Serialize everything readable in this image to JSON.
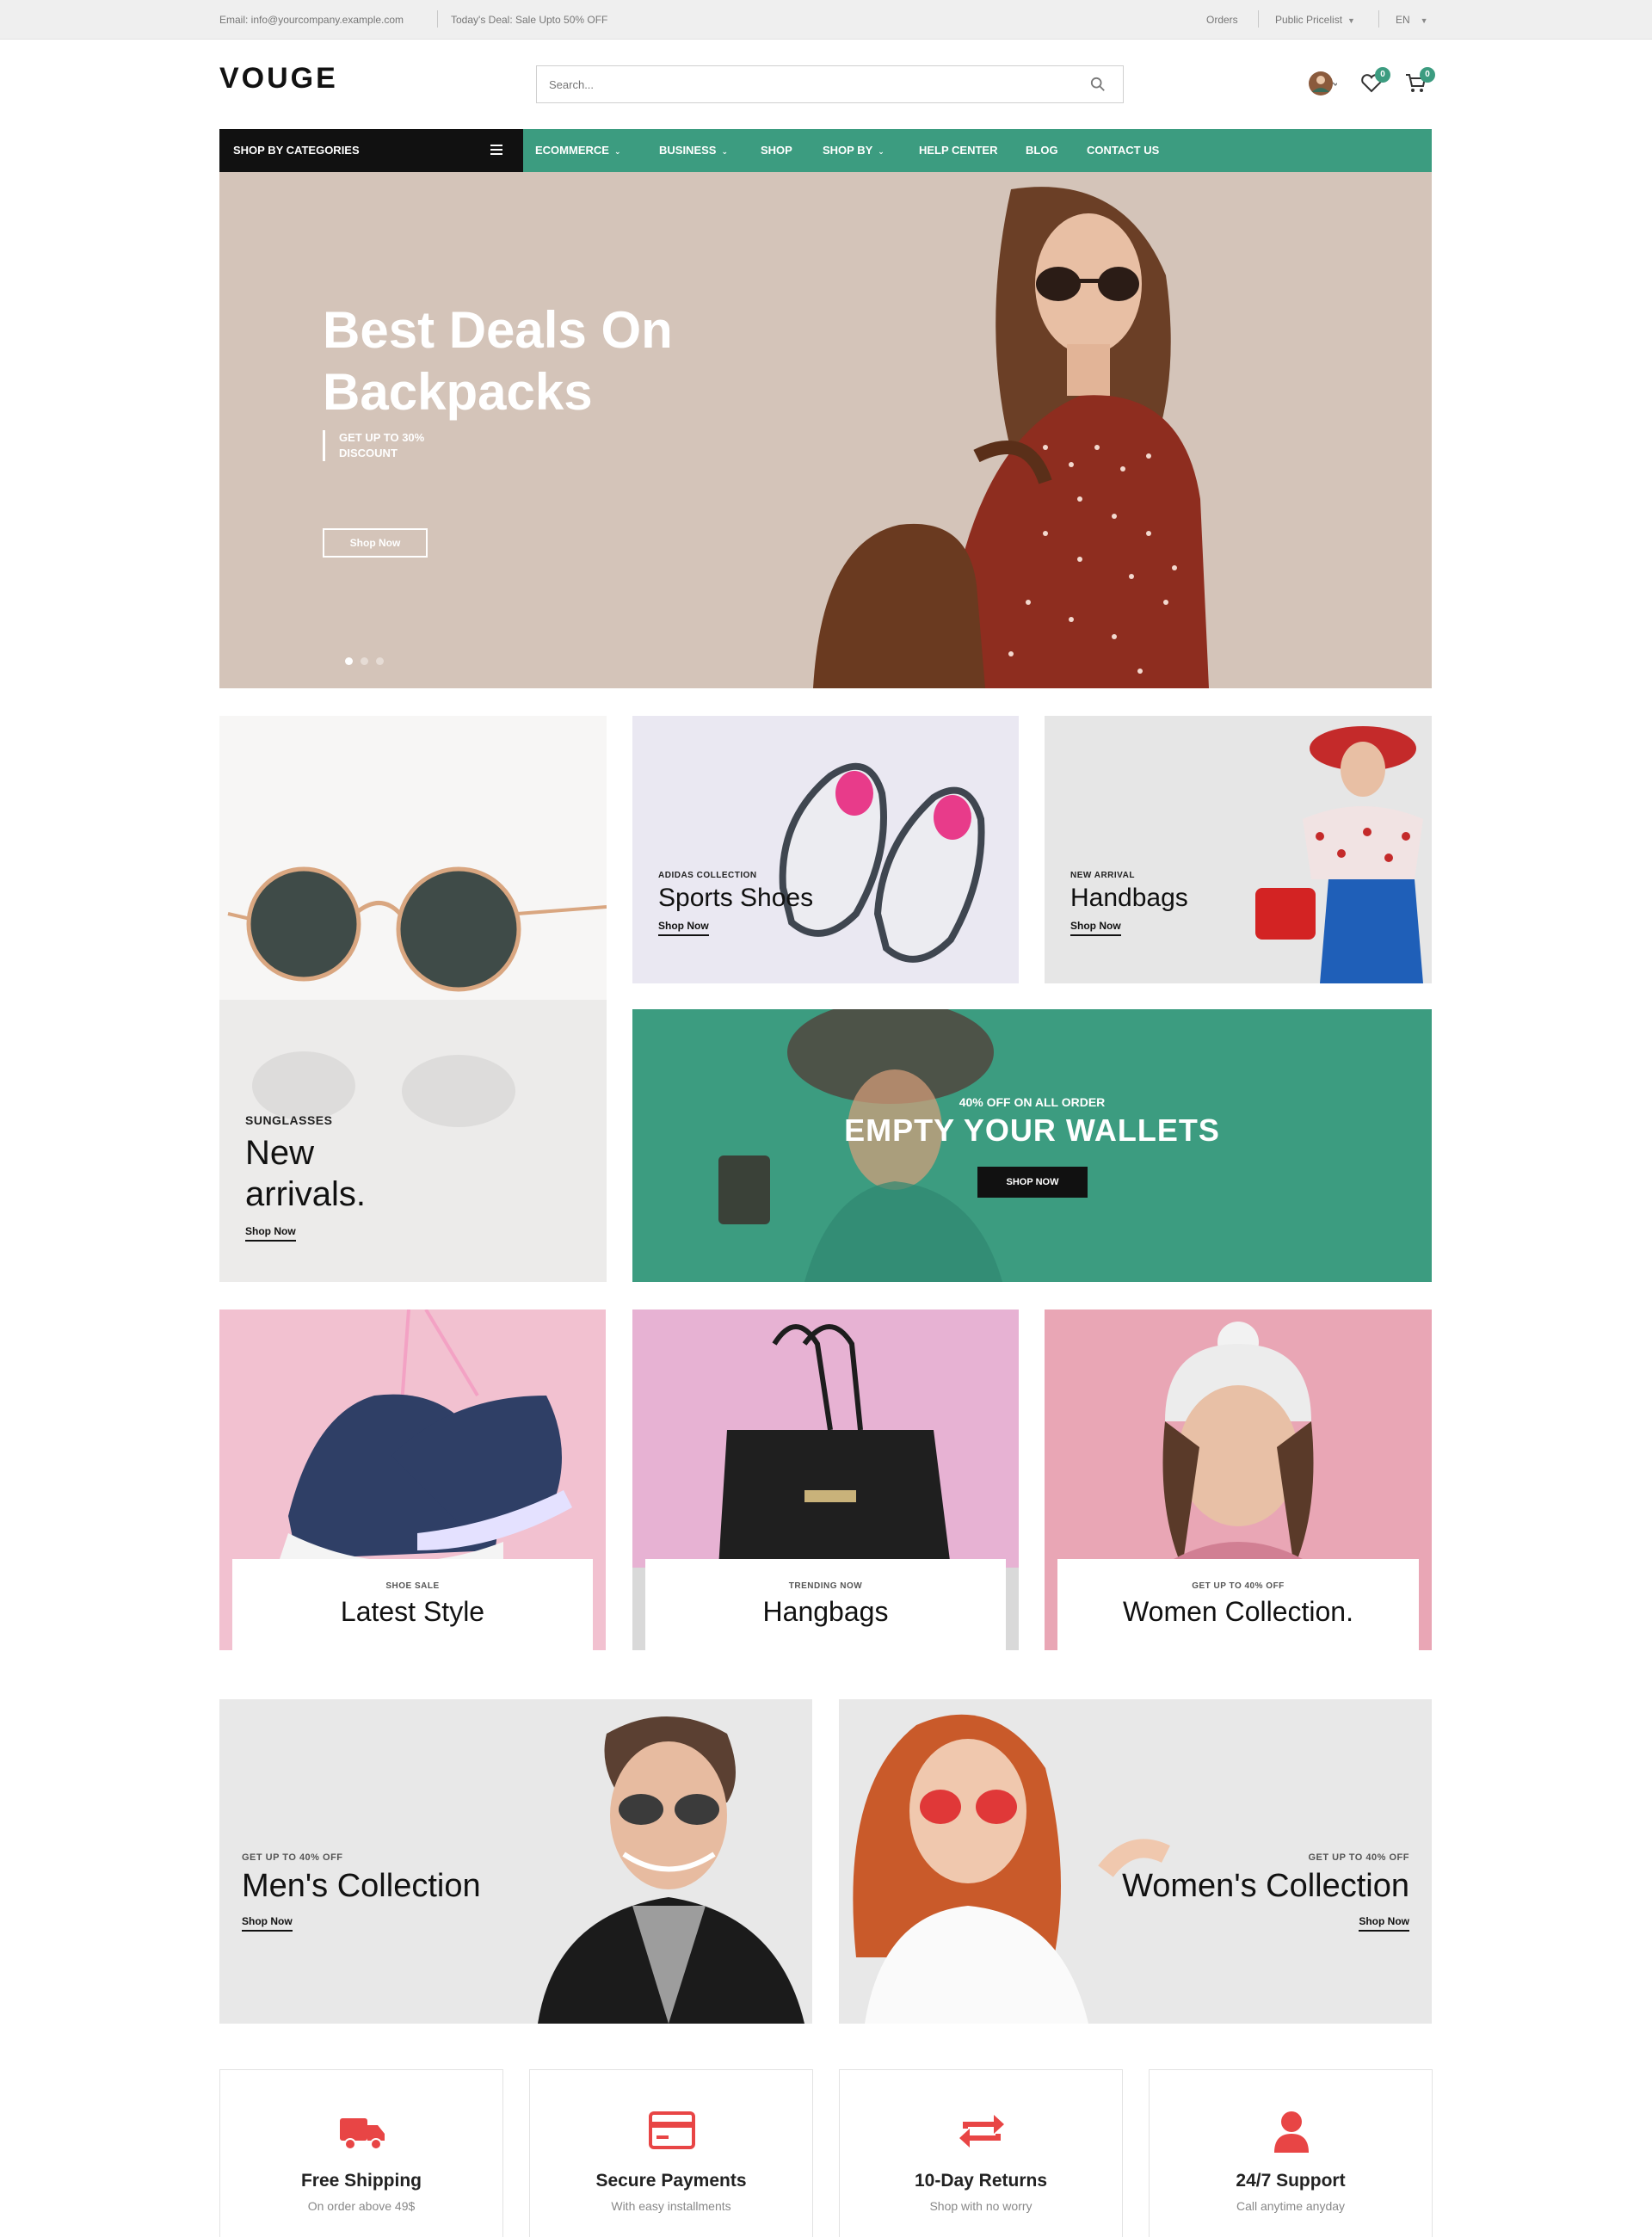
{
  "topbar": {
    "email": "Email:  info@yourcompany.example.com",
    "deal": "Today's Deal:  Sale Upto 50% OFF",
    "orders": "Orders",
    "pricelist": "Public Pricelist",
    "language": "EN"
  },
  "header": {
    "logo": "VOUGE",
    "search_placeholder": "Search...",
    "wishlist_count": "0",
    "cart_count": "0"
  },
  "nav": {
    "categories_label": "SHOP BY CATEGORIES",
    "items": [
      "ECOMMERCE",
      "BUSINESS",
      "SHOP",
      "SHOP BY",
      "HELP CENTER",
      "BLOG",
      "CONTACT US"
    ]
  },
  "hero": {
    "title_line1": "Best Deals On",
    "title_line2": "Backpacks",
    "subtitle_line1": "GET UP TO 30%",
    "subtitle_line2": "DISCOUNT",
    "button": "Shop Now",
    "slides": 3,
    "active_slide": 1
  },
  "banners": {
    "sunglasses": {
      "label": "SUNGLASSES",
      "title_line1": "New",
      "title_line2": "arrivals.",
      "link": "Shop Now"
    },
    "shoes": {
      "label": "ADIDAS COLLECTION",
      "title": "Sports Shoes",
      "link": "Shop Now"
    },
    "handbags": {
      "label": "NEW ARRIVAL",
      "title": "Handbags",
      "link": "Shop Now"
    },
    "promo": {
      "label": "40% OFF ON ALL ORDER",
      "title": "EMPTY YOUR WALLETS",
      "button": "SHOP NOW"
    }
  },
  "tiles": [
    {
      "label": "SHOE SALE",
      "title": "Latest Style"
    },
    {
      "label": "TRENDING NOW",
      "title": "Hangbags"
    },
    {
      "label": "GET UP TO 40% OFF",
      "title": "Women Collection."
    }
  ],
  "collections": {
    "men": {
      "label": "GET UP TO 40% OFF",
      "title": "Men's Collection",
      "link": "Shop Now"
    },
    "women": {
      "label": "GET UP TO 40% OFF",
      "title": "Women's Collection",
      "link": "Shop Now"
    }
  },
  "features": [
    {
      "icon": "truck-icon",
      "title": "Free Shipping",
      "subtitle": "On order above 49$"
    },
    {
      "icon": "credit-card-icon",
      "title": "Secure Payments",
      "subtitle": "With easy installments"
    },
    {
      "icon": "returns-icon",
      "title": "10-Day Returns",
      "subtitle": "Shop with no worry"
    },
    {
      "icon": "user-icon",
      "title": "24/7 Support",
      "subtitle": "Call anytime anyday"
    }
  ],
  "colors": {
    "accent": "#3c9c80",
    "feature_icon": "#e84545",
    "hero_bg": "#d4c4b9",
    "dark": "#111111"
  }
}
